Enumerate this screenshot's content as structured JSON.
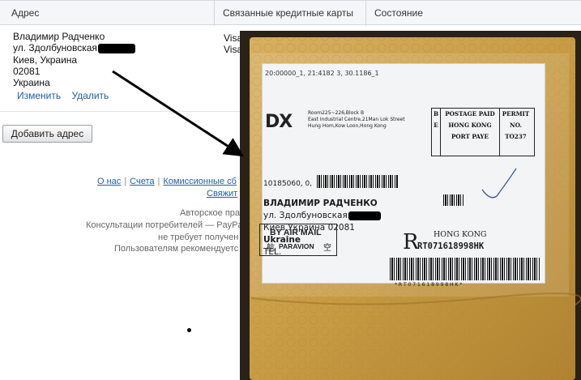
{
  "table": {
    "headers": [
      "Адрес",
      "Связанные кредитные карты",
      "Состояние"
    ],
    "address_lines": [
      "Владимир Радченко",
      "ул. Здолбуновская",
      "Киев, Украина",
      "02081",
      "Украина"
    ],
    "edit_link": "Изменить",
    "delete_link": "Удалить",
    "cards": [
      "Visa",
      "Visa"
    ]
  },
  "add_address_button": "Добавить адрес",
  "footer": {
    "links": [
      "О нас",
      "Счета",
      "Комиссионные сб"
    ],
    "link_second_line": "Свяжит",
    "legal_lines": [
      "Авторское пра",
      "Консультации потребителей — PayPa",
      "не требует получен",
      "Пользователям рекомендуетс"
    ]
  },
  "photo_label": {
    "tracking_top": "20:00000_1, 21:4182 3, 30.1186_1",
    "logo": "DX",
    "sender_address": [
      "Room225~226,Block B",
      "East Industrial Centre,21Man Lok Street",
      "Hung Hom,Kow Loon,Hong Kong"
    ],
    "postage": {
      "left_col": [
        "B",
        "",
        "E"
      ],
      "center_col": [
        "POSTAGE PAID",
        "HONG KONG",
        "PORT PAYE"
      ],
      "right_col": [
        "PERMIT",
        "NO.",
        "TO237"
      ]
    },
    "ref_number": "10185060, 0,",
    "recipient": [
      "ВЛАДИМИР РАДЧЕНКО",
      "ул. Здолбуновская",
      "Киев Украина 02081",
      "Ukraine",
      "TEL."
    ],
    "registered_letter": "R",
    "country": "HONG KONG",
    "tracking_number": "RT071618998HK",
    "barcode_caption": "* R T 0 7 1 6 1 8 9 9 8 H K *",
    "airmail": [
      "BY AIR MAIL",
      "航",
      "PARAVION",
      "空"
    ]
  },
  "colors": {
    "link": "#1f5fa7",
    "header_bg": "#f4f6f8",
    "envelope": "#c49a3e",
    "label": "#f3f4f6"
  }
}
